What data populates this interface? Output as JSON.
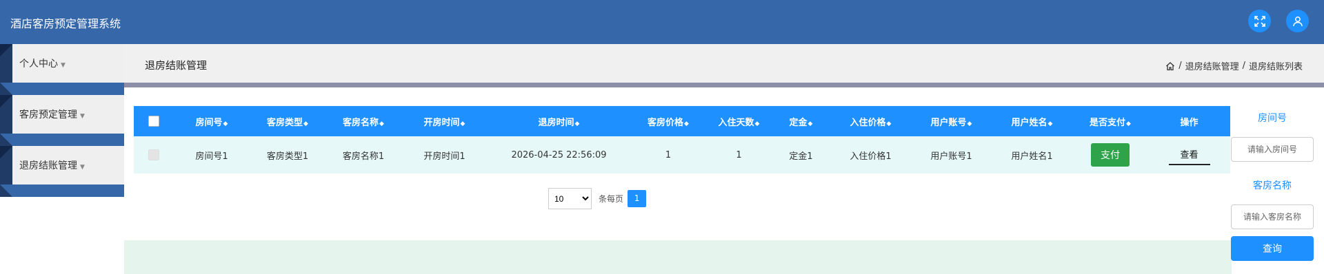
{
  "header": {
    "title": "酒店客房预定管理系统",
    "icons": [
      "fullscreen-icon",
      "user-icon"
    ]
  },
  "sidebar": {
    "items": [
      {
        "label": "个人中心"
      },
      {
        "label": "客房预定管理"
      },
      {
        "label": "退房结账管理"
      }
    ]
  },
  "breadcrumb": {
    "page_title": "退房结账管理",
    "home_icon": "home-icon",
    "items": [
      "退房结账管理",
      "退房结账列表"
    ],
    "separator": "/"
  },
  "table": {
    "columns": [
      "房间号",
      "客房类型",
      "客房名称",
      "开房时间",
      "退房时间",
      "客房价格",
      "入住天数",
      "定金",
      "入住价格",
      "用户账号",
      "用户姓名",
      "是否支付",
      "操作"
    ],
    "rows": [
      {
        "room_no": "房间号1",
        "room_type": "客房类型1",
        "room_name": "客房名称1",
        "checkin_time": "开房时间1",
        "checkout_time": "2026-04-25 22:56:09",
        "price": "1",
        "days": "1",
        "deposit": "定金1",
        "stay_price": "入住价格1",
        "account": "用户账号1",
        "user_name": "用户姓名1",
        "pay_label": "支付",
        "view_label": "查看"
      }
    ]
  },
  "pagination": {
    "page_size": "10",
    "page_size_options": [
      "10"
    ],
    "per_page_label": "条每页",
    "current_page": "1"
  },
  "search": {
    "room_no_label": "房间号",
    "room_no_placeholder": "请输入房间号",
    "room_name_label": "客房名称",
    "room_name_placeholder": "请输入客房名称",
    "query_label": "查询"
  },
  "colors": {
    "header_bg": "#3667a9",
    "accent": "#1e90ff",
    "pay_button": "#2ea34a",
    "row_bg": "#e6f8f8"
  }
}
